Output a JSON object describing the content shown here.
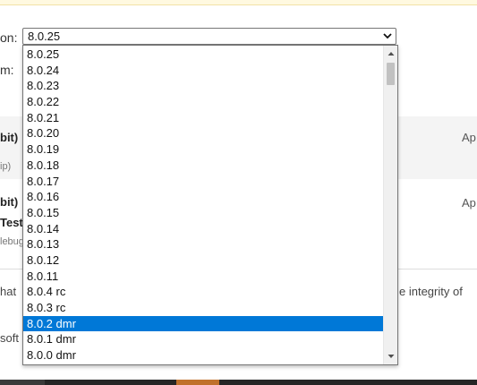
{
  "form": {
    "version_label": "on:",
    "platform_label": "m:",
    "selected_value": "8.0.25"
  },
  "background_fragments": {
    "bit1": "bit)",
    "zip": "ip)",
    "bit2": "bit)",
    "test": "Test",
    "debug": "lebug",
    "ap1": "Ap",
    "ap2": "Ap",
    "that": "hat",
    "integrity": "e integrity of",
    "soft": "soft"
  },
  "dropdown": {
    "options": [
      "8.0.25",
      "8.0.24",
      "8.0.23",
      "8.0.22",
      "8.0.21",
      "8.0.20",
      "8.0.19",
      "8.0.18",
      "8.0.17",
      "8.0.16",
      "8.0.15",
      "8.0.14",
      "8.0.13",
      "8.0.12",
      "8.0.11",
      "8.0.4 rc",
      "8.0.3 rc",
      "8.0.2 dmr",
      "8.0.1 dmr",
      "8.0.0 dmr"
    ],
    "highlighted": "8.0.2 dmr"
  },
  "colors": {
    "highlight": "#0078d7",
    "notice": "#fff9e0",
    "band": "#f4f4f4",
    "accent_bar": "#c0702b"
  },
  "icons": {
    "select_arrow": "chevron-down-icon",
    "scroll_up": "triangle-up-icon",
    "scroll_down": "triangle-down-icon"
  }
}
